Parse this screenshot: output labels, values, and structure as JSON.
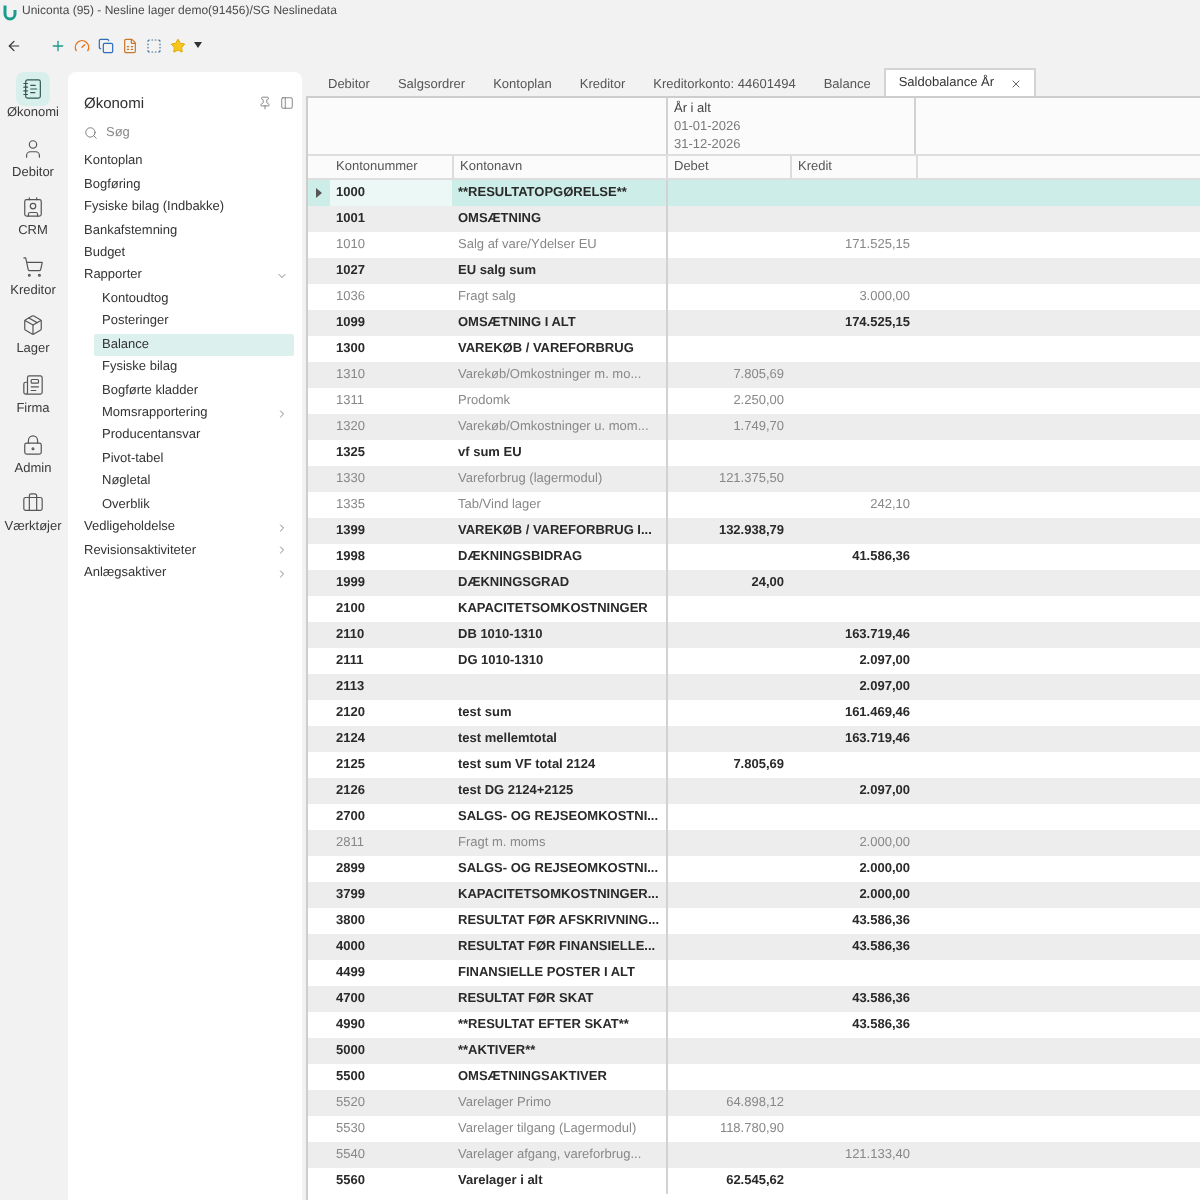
{
  "window": {
    "title": "Uniconta (95) - Nesline lager demo(91456)/SG Neslinedata"
  },
  "rail": [
    {
      "label": "Økonomi",
      "selected": true
    },
    {
      "label": "Debitor",
      "selected": false
    },
    {
      "label": "CRM",
      "selected": false
    },
    {
      "label": "Kreditor",
      "selected": false
    },
    {
      "label": "Lager",
      "selected": false
    },
    {
      "label": "Firma",
      "selected": false
    },
    {
      "label": "Admin",
      "selected": false
    },
    {
      "label": "Værktøjer",
      "selected": false
    }
  ],
  "nav": {
    "title": "Økonomi",
    "search": {
      "placeholder": "Søg"
    },
    "items": [
      {
        "label": "Kontoplan",
        "kind": "page",
        "selected": false
      },
      {
        "label": "Bogføring",
        "kind": "page",
        "selected": false
      },
      {
        "label": "Fysiske bilag (Indbakke)",
        "kind": "page",
        "selected": false
      },
      {
        "label": "Bankafstemning",
        "kind": "page",
        "selected": false
      },
      {
        "label": "Budget",
        "kind": "page",
        "selected": false
      },
      {
        "label": "Rapporter",
        "kind": "group",
        "expanded": true,
        "selected": false,
        "children": [
          {
            "label": "Kontoudtog",
            "kind": "page",
            "selected": false
          },
          {
            "label": "Posteringer",
            "kind": "page",
            "selected": false
          },
          {
            "label": "Balance",
            "kind": "page",
            "selected": true
          },
          {
            "label": "Fysiske bilag",
            "kind": "page",
            "selected": false
          },
          {
            "label": "Bogførte kladder",
            "kind": "page",
            "selected": false
          },
          {
            "label": "Momsrapportering",
            "kind": "group",
            "expanded": false,
            "selected": false
          },
          {
            "label": "Producentansvar",
            "kind": "page",
            "selected": false
          },
          {
            "label": "Pivot-tabel",
            "kind": "page",
            "selected": false
          },
          {
            "label": "Nøgletal",
            "kind": "page",
            "selected": false
          },
          {
            "label": "Overblik",
            "kind": "page",
            "selected": false
          }
        ]
      },
      {
        "label": "Vedligeholdelse",
        "kind": "group",
        "expanded": false,
        "selected": false
      },
      {
        "label": "Revisionsaktiviteter",
        "kind": "group",
        "expanded": false,
        "selected": false
      },
      {
        "label": "Anlægsaktiver",
        "kind": "group",
        "expanded": false,
        "selected": false
      }
    ]
  },
  "tabs": [
    {
      "label": "Debitor",
      "selected": false
    },
    {
      "label": "Salgsordrer",
      "selected": false
    },
    {
      "label": "Kontoplan",
      "selected": false
    },
    {
      "label": "Kreditor",
      "selected": false
    },
    {
      "label": "Kreditorkonto: 44601494",
      "selected": false
    },
    {
      "label": "Balance",
      "selected": false
    },
    {
      "label": "Saldobalance År",
      "selected": true
    }
  ],
  "table": {
    "band": {
      "title": "År i alt",
      "from": "01-01-2026",
      "to": "31-12-2026"
    },
    "columns": [
      "Kontonummer",
      "Kontonavn",
      "Debet",
      "Kredit"
    ],
    "rows": [
      {
        "number": "1000",
        "name": "**RESULTATOPGØRELSE**",
        "kind": "total",
        "selected": true
      },
      {
        "number": "1001",
        "name": "OMSÆTNING",
        "kind": "total",
        "selected": false
      },
      {
        "number": "1010",
        "name": "Salg af vare/Ydelser EU",
        "kredit": "171.525,15",
        "kind": "account",
        "selected": false
      },
      {
        "number": "1027",
        "name": "EU salg sum",
        "kind": "total",
        "selected": false
      },
      {
        "number": "1036",
        "name": "Fragt salg",
        "kredit": "3.000,00",
        "kind": "account",
        "selected": false
      },
      {
        "number": "1099",
        "name": "OMSÆTNING I ALT",
        "kredit": "174.525,15",
        "kind": "total",
        "selected": false
      },
      {
        "number": "1300",
        "name": "VAREKØB / VAREFORBRUG",
        "kind": "total",
        "selected": false
      },
      {
        "number": "1310",
        "name": "Varekøb/Omkostninger m. mo...",
        "debet": "7.805,69",
        "kind": "account",
        "selected": false
      },
      {
        "number": "1311",
        "name": "Prodomk",
        "debet": "2.250,00",
        "kind": "account",
        "selected": false
      },
      {
        "number": "1320",
        "name": "Varekøb/Omkostninger u. mom...",
        "debet": "1.749,70",
        "kind": "account",
        "selected": false
      },
      {
        "number": "1325",
        "name": "vf sum EU",
        "kind": "total",
        "selected": false
      },
      {
        "number": "1330",
        "name": "Vareforbrug (lagermodul)",
        "debet": "121.375,50",
        "kind": "account",
        "selected": false
      },
      {
        "number": "1335",
        "name": "Tab/Vind lager",
        "kredit": "242,10",
        "kind": "account",
        "selected": false
      },
      {
        "number": "1399",
        "name": "VAREKØB / VAREFORBRUG I...",
        "debet": "132.938,79",
        "kind": "total",
        "selected": false
      },
      {
        "number": "1998",
        "name": "DÆKNINGSBIDRAG",
        "kredit": "41.586,36",
        "kind": "total",
        "selected": false
      },
      {
        "number": "1999",
        "name": "DÆKNINGSGRAD",
        "debet": "24,00",
        "kind": "total",
        "selected": false
      },
      {
        "number": "2100",
        "name": "KAPACITETSOMKOSTNINGER",
        "kind": "total",
        "selected": false
      },
      {
        "number": "2110",
        "name": "DB 1010-1310",
        "kredit": "163.719,46",
        "kind": "total",
        "selected": false
      },
      {
        "number": "2111",
        "name": "DG 1010-1310",
        "kredit": "2.097,00",
        "kind": "total",
        "selected": false
      },
      {
        "number": "2113",
        "kredit": "2.097,00",
        "kind": "total",
        "selected": false
      },
      {
        "number": "2120",
        "name": "test sum",
        "kredit": "161.469,46",
        "kind": "total",
        "selected": false
      },
      {
        "number": "2124",
        "name": "test mellemtotal",
        "kredit": "163.719,46",
        "kind": "total",
        "selected": false
      },
      {
        "number": "2125",
        "name": "test sum VF total 2124",
        "debet": "7.805,69",
        "kind": "total",
        "selected": false
      },
      {
        "number": "2126",
        "name": "test DG 2124+2125",
        "kredit": "2.097,00",
        "kind": "total",
        "selected": false
      },
      {
        "number": "2700",
        "name": "SALGS- OG REJSEOMKOSTNI...",
        "kind": "total",
        "selected": false
      },
      {
        "number": "2811",
        "name": "Fragt m. moms",
        "kredit": "2.000,00",
        "kind": "account",
        "selected": false
      },
      {
        "number": "2899",
        "name": "SALGS- OG REJSEOMKOSTNI...",
        "kredit": "2.000,00",
        "kind": "total",
        "selected": false
      },
      {
        "number": "3799",
        "name": "KAPACITETSOMKOSTNINGER...",
        "kredit": "2.000,00",
        "kind": "total",
        "selected": false
      },
      {
        "number": "3800",
        "name": "RESULTAT FØR AFSKRIVNING...",
        "kredit": "43.586,36",
        "kind": "total",
        "selected": false
      },
      {
        "number": "4000",
        "name": "RESULTAT FØR FINANSIELLE...",
        "kredit": "43.586,36",
        "kind": "total",
        "selected": false
      },
      {
        "number": "4499",
        "name": "FINANSIELLE POSTER I ALT",
        "kind": "total",
        "selected": false
      },
      {
        "number": "4700",
        "name": "RESULTAT FØR SKAT",
        "kredit": "43.586,36",
        "kind": "total",
        "selected": false
      },
      {
        "number": "4990",
        "name": "**RESULTAT EFTER SKAT**",
        "kredit": "43.586,36",
        "kind": "total",
        "selected": false
      },
      {
        "number": "5000",
        "name": "**AKTIVER**",
        "kind": "total",
        "selected": false
      },
      {
        "number": "5500",
        "name": "OMSÆTNINGSAKTIVER",
        "kind": "total",
        "selected": false
      },
      {
        "number": "5520",
        "name": "Varelager Primo",
        "debet": "64.898,12",
        "kind": "account",
        "selected": false
      },
      {
        "number": "5530",
        "name": "Varelager tilgang (Lagermodul)",
        "debet": "118.780,90",
        "kind": "account",
        "selected": false
      },
      {
        "number": "5540",
        "name": "Varelager afgang, vareforbrug...",
        "kredit": "121.133,40",
        "kind": "account",
        "selected": false
      },
      {
        "number": "5560",
        "name": "Varelager i alt",
        "debet": "62.545,62",
        "kind": "total",
        "selected": false
      }
    ]
  }
}
